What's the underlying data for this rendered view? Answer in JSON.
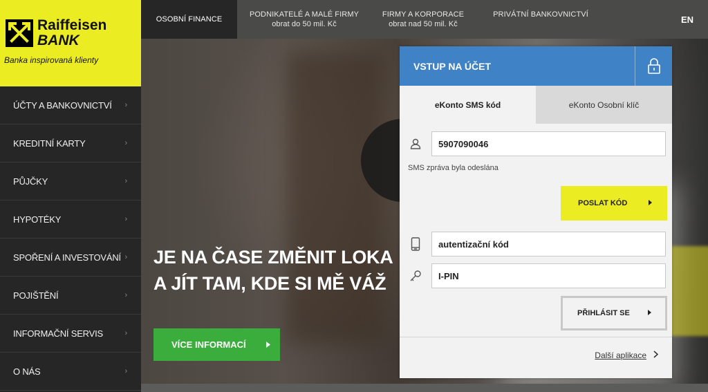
{
  "top_nav": {
    "tabs": [
      {
        "label": "OSOBNÍ FINANCE",
        "sub": ""
      },
      {
        "label": "PODNIKATELÉ A MALÉ FIRMY",
        "sub": "obrat do 50 mil. Kč"
      },
      {
        "label": "FIRMY A KORPORACE",
        "sub": "obrat nad 50 mil. Kč"
      },
      {
        "label": "PRIVÁTNÍ BANKOVNICTVÍ",
        "sub": ""
      }
    ],
    "lang": "EN"
  },
  "logo": {
    "name_line1": "Raiffeisen",
    "name_line2": "BANK",
    "tagline": "Banka inspirovaná klienty",
    "brand_color": "#ecec22"
  },
  "side_menu": {
    "items": [
      {
        "label": "ÚČTY A BANKOVNICTVÍ"
      },
      {
        "label": "KREDITNÍ KARTY"
      },
      {
        "label": "PŮJČKY"
      },
      {
        "label": "HYPOTÉKY"
      },
      {
        "label": "SPOŘENÍ A INVESTOVÁNÍ"
      },
      {
        "label": "POJIŠTĚNÍ"
      },
      {
        "label": "INFORMAČNÍ SERVIS"
      },
      {
        "label": "O NÁS"
      }
    ],
    "chevron": "›"
  },
  "hero": {
    "headline_line1": "JE NA ČASE ZMĚNIT LOKA",
    "headline_line2": "A JÍT TAM, KDE SI MĚ VÁŽ",
    "cta_label": "VÍCE INFORMACÍ",
    "cta_color": "#3aad3c"
  },
  "login": {
    "title": "VSTUP NA ÚČET",
    "header_color": "#3f82c6",
    "tabs": [
      {
        "label": "eKonto SMS kód",
        "active": true
      },
      {
        "label": "eKonto Osobní klíč",
        "active": false
      }
    ],
    "username_value": "5907090046",
    "sms_note": "SMS zpráva byla odeslána",
    "send_code_label": "POSLAT KÓD",
    "auth_code_placeholder": "autentizační kód",
    "ipin_placeholder": "I-PIN",
    "login_button_label": "PŘIHLÁSIT SE",
    "more_apps_label": "Další aplikace",
    "icons": [
      "lock-icon",
      "user-icon",
      "phone-icon",
      "key-icon"
    ]
  }
}
